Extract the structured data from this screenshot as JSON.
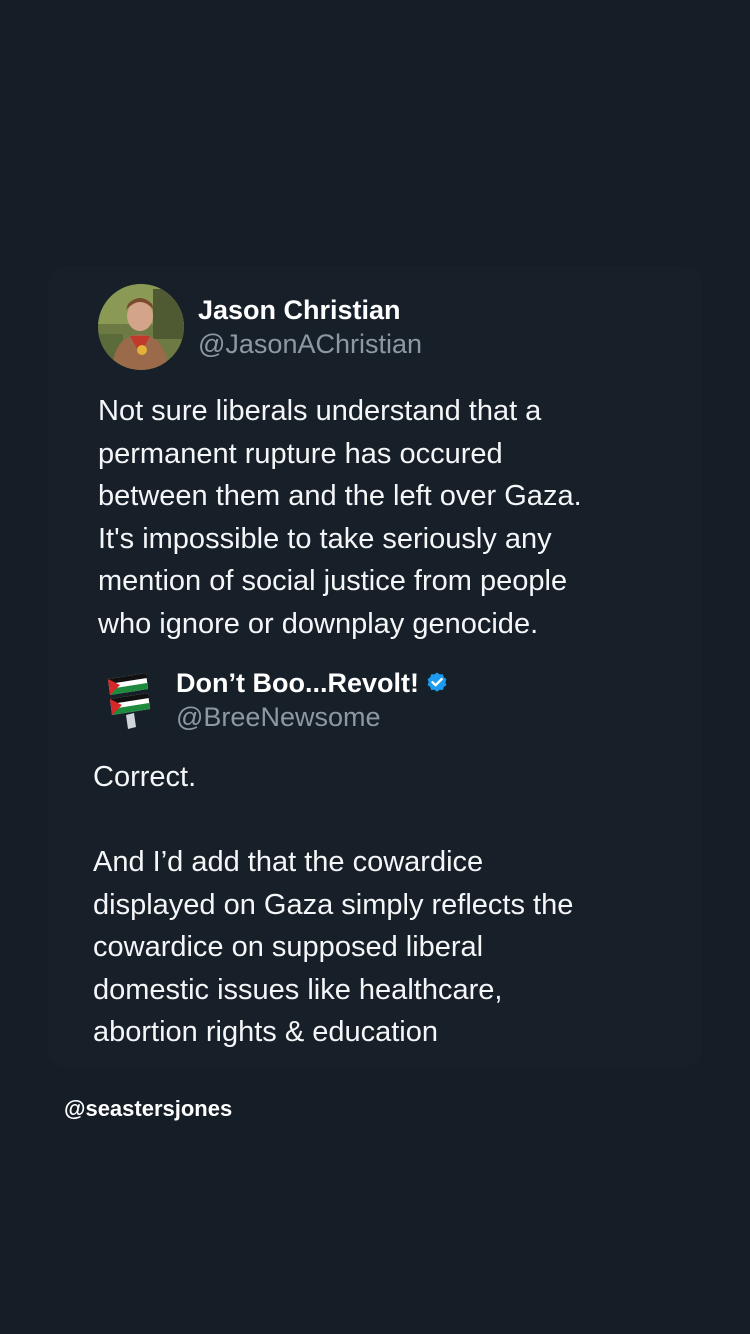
{
  "main_tweet": {
    "display_name": "Jason Christian",
    "handle": "@JasonAChristian",
    "text": "Not sure liberals understand that a\npermanent rupture has occured\nbetween them and the left over Gaza.\nIt's impossible to take seriously any\nmention of social justice from people\nwho ignore or downplay genocide."
  },
  "quoted_tweet": {
    "display_name": "Don’t Boo...Revolt!",
    "handle": "@BreeNewsome",
    "verified": true,
    "verified_color": "#1d9bf0",
    "text": "Correct.\n\nAnd I’d add that the cowardice\ndisplayed on Gaza simply reflects the\ncowardice on supposed liberal\ndomestic issues like healthcare,\nabortion rights & education"
  },
  "watermark": "@seastersjones",
  "colors": {
    "background": "#151d27",
    "card": "#172029",
    "text": "#f4f6f8",
    "handle": "#8e98a3"
  }
}
